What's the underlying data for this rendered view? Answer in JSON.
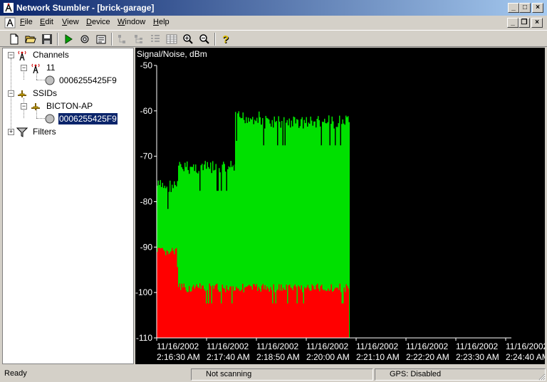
{
  "window": {
    "title": "Network Stumbler - [brick-garage]",
    "minimize": "_",
    "maximize": "□",
    "close": "×",
    "mdi_restore": "❐"
  },
  "menu": {
    "items": [
      "File",
      "Edit",
      "View",
      "Device",
      "Window",
      "Help"
    ]
  },
  "toolbar": {
    "buttons": [
      "new-icon",
      "open-icon",
      "save-icon",
      "play-icon",
      "auto-config-icon",
      "properties-icon",
      "tree-icon-1",
      "tree-icon-2",
      "list-icon",
      "grid-icon",
      "zoom-in-icon",
      "zoom-out-icon",
      "help-icon"
    ]
  },
  "tree": {
    "channels_label": "Channels",
    "channel_11": "11",
    "channel_ap_mac": "0006255425F9",
    "ssids_label": "SSIDs",
    "ssid_name": "BICTON-AP",
    "ssid_ap_mac": "0006255425F9",
    "filters_label": "Filters"
  },
  "chart_data": {
    "type": "bar",
    "title": "Signal/Noise, dBm",
    "ylabel": "Signal/Noise, dBm",
    "ylim": [
      -110,
      -50
    ],
    "yticks": [
      -50,
      -60,
      -70,
      -80,
      -90,
      -100,
      -110
    ],
    "xticks": [
      {
        "date": "11/16/2002",
        "time": "2:16:30 AM"
      },
      {
        "date": "11/16/2002",
        "time": "2:17:40 AM"
      },
      {
        "date": "11/16/2002",
        "time": "2:18:50 AM"
      },
      {
        "date": "11/16/2002",
        "time": "2:20:00 AM"
      },
      {
        "date": "11/16/2002",
        "time": "2:21:10 AM"
      },
      {
        "date": "11/16/2002",
        "time": "2:22:20 AM"
      },
      {
        "date": "11/16/2002",
        "time": "2:23:30 AM"
      },
      {
        "date": "11/16/2002",
        "time": "2:24:40 AM"
      }
    ],
    "series": [
      {
        "name": "Signal",
        "color": "#00e000",
        "segments": [
          {
            "start": "2:16:30 AM",
            "end": "2:17:00 AM",
            "value": -75
          },
          {
            "start": "2:17:00 AM",
            "end": "2:18:20 AM",
            "value": -71
          },
          {
            "start": "2:18:20 AM",
            "end": "2:18:55 AM",
            "value": -60
          },
          {
            "start": "2:18:55 AM",
            "end": "2:21:00 AM",
            "value": -61
          }
        ]
      },
      {
        "name": "Noise",
        "color": "#ff0000",
        "segments": [
          {
            "start": "2:16:30 AM",
            "end": "2:17:00 AM",
            "value": -90
          },
          {
            "start": "2:17:00 AM",
            "end": "2:21:00 AM",
            "value": -98
          }
        ]
      }
    ],
    "background": "#000000",
    "grid": false
  },
  "status": {
    "ready": "Ready",
    "scanning": "Not scanning",
    "gps": "GPS: Disabled"
  }
}
